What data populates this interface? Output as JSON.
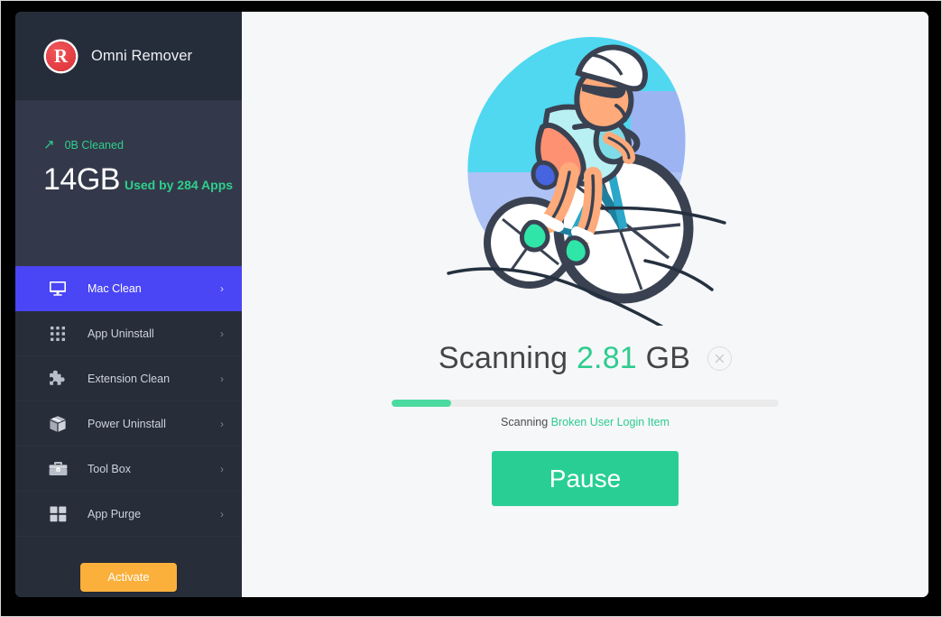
{
  "app": {
    "brand_name": "Omni Remover",
    "logo_letter": "R"
  },
  "stats": {
    "cleaned_arrow": "↗",
    "cleaned_text": "0B Cleaned",
    "used_size": "14GB",
    "used_label": "Used by 284 Apps"
  },
  "sidebar": {
    "items": [
      {
        "label": "Mac Clean",
        "icon": "monitor-icon",
        "chevron": "›",
        "active": true
      },
      {
        "label": "App Uninstall",
        "icon": "grid-dots-icon",
        "chevron": "›",
        "active": false
      },
      {
        "label": "Extension Clean",
        "icon": "puzzle-icon",
        "chevron": "›",
        "active": false
      },
      {
        "label": "Power Uninstall",
        "icon": "box-icon",
        "chevron": "›",
        "active": false
      },
      {
        "label": "Tool Box",
        "icon": "toolbox-icon",
        "chevron": "›",
        "active": false
      },
      {
        "label": "App Purge",
        "icon": "squares-icon",
        "chevron": "›",
        "active": false
      }
    ],
    "activate_label": "Activate"
  },
  "main": {
    "illustration": "cyclist-illustration",
    "status_prefix": "Scanning ",
    "status_size": "2.81",
    "status_suffix": " GB",
    "cancel_icon": "close-circle-icon",
    "progress_percent": 15.5,
    "progress_prefix": "Scanning ",
    "progress_item": "Broken User Login Item",
    "pause_label": "Pause"
  },
  "colors": {
    "accent_blue": "#4a45f5",
    "accent_green": "#2ecc8f",
    "progress_green": "#4bdba0",
    "pause_green": "#29ce95",
    "activate_orange": "#fbb03b",
    "logo_red": "#e23b40",
    "sidebar_dark": "#272e3a",
    "stats_panel": "#33394a",
    "main_bg": "#f6f7f9"
  }
}
